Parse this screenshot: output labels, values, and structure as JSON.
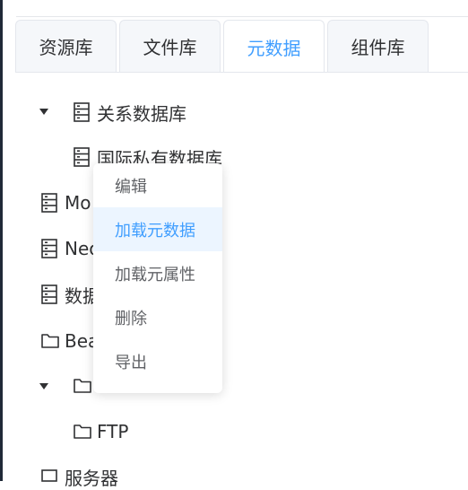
{
  "tabs": [
    {
      "label": "资源库",
      "active": false
    },
    {
      "label": "文件库",
      "active": false
    },
    {
      "label": "元数据",
      "active": true
    },
    {
      "label": "组件库",
      "active": false
    }
  ],
  "tree": {
    "relational_db": "关系数据库",
    "child_db_partial": "国际私有数据库",
    "mongo_partial": "Mo",
    "neo_partial": "Neo",
    "data_partial": "数据",
    "bea_partial": "Bea",
    "ftp": "FTP",
    "servers": "服务器"
  },
  "context_menu": {
    "items": [
      "编辑",
      "加载元数据",
      "加载元属性",
      "删除",
      "导出"
    ],
    "highlighted_index": 1
  },
  "colors": {
    "accent": "#409eff",
    "hover_bg": "#ecf5ff",
    "tab_bg": "#f5f7fa"
  }
}
